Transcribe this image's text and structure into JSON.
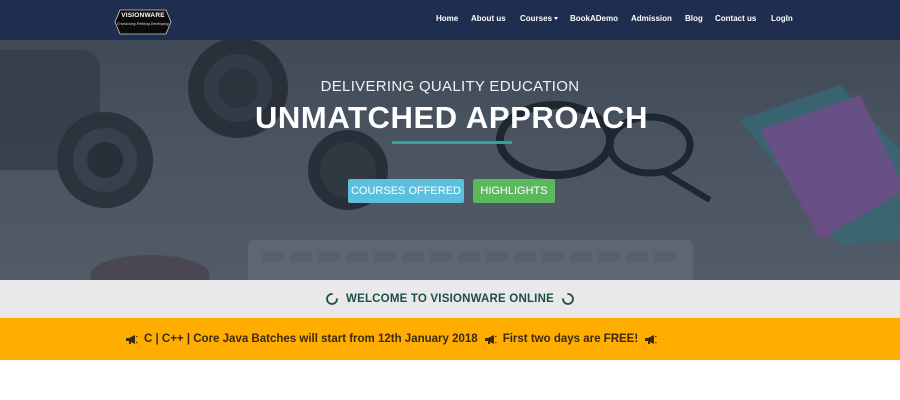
{
  "brand": {
    "name": "VISIONWARE",
    "tagline": "Envisioning Refining Developing"
  },
  "nav": {
    "items": [
      {
        "label": "Home"
      },
      {
        "label": "About us"
      },
      {
        "label": "Courses"
      },
      {
        "label": "BookADemo"
      },
      {
        "label": "Admission"
      },
      {
        "label": "Blog"
      },
      {
        "label": "Contact us"
      },
      {
        "label": "LogIn"
      }
    ]
  },
  "hero": {
    "subtitle": "DELIVERING QUALITY EDUCATION",
    "title": "UNMATCHED APPROACH",
    "buttons": {
      "courses": "COURSES OFFERED",
      "highlights": "HIGHLIGHTS"
    }
  },
  "welcome": {
    "text": "WELCOME TO VISIONWARE ONLINE"
  },
  "announcement": {
    "part1": "C | C++ | Core Java Batches will start from 12th January 2018",
    "part2": "First two days are FREE!"
  },
  "colors": {
    "navbar_bg": "#1f2d4e",
    "accent_teal": "#2aa5a0",
    "btn_info": "#5bc0de",
    "btn_success": "#5cb85c",
    "welcome_bg": "#e9e9ea",
    "welcome_text": "#1e4d4b",
    "announce_bg": "#ffad00"
  },
  "icons": {
    "dropdown": "caret-down-icon",
    "welcome": "spinner-icon",
    "announce": "megaphone-icon"
  }
}
